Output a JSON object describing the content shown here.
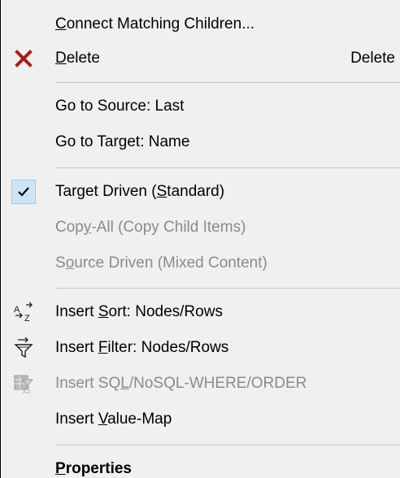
{
  "menu": {
    "items": [
      {
        "pre": "",
        "u": "C",
        "post": "onnect Matching Children...",
        "shortcut": "",
        "disabled": false
      },
      {
        "pre": "",
        "u": "D",
        "post": "elete",
        "shortcut": "Delete",
        "disabled": false
      },
      {
        "pre": "Go to Source: Last",
        "u": "",
        "post": "",
        "shortcut": "",
        "disabled": false
      },
      {
        "pre": "Go to Target: Name",
        "u": "",
        "post": "",
        "shortcut": "",
        "disabled": false
      },
      {
        "pre": "Target Driven (",
        "u": "S",
        "post": "tandard)",
        "shortcut": "",
        "disabled": false,
        "checked": true
      },
      {
        "pre": "Cop",
        "u": "y",
        "post": "-All (Copy Child Items)",
        "shortcut": "",
        "disabled": true
      },
      {
        "pre": "S",
        "u": "o",
        "post": "urce Driven (Mixed Content)",
        "shortcut": "",
        "disabled": true
      },
      {
        "pre": "Insert ",
        "u": "S",
        "post": "ort: Nodes/Rows",
        "shortcut": "",
        "disabled": false
      },
      {
        "pre": "Insert ",
        "u": "F",
        "post": "ilter: Nodes/Rows",
        "shortcut": "",
        "disabled": false
      },
      {
        "pre": "Insert SQ",
        "u": "L",
        "post": "/NoSQL-WHERE/ORDER",
        "shortcut": "",
        "disabled": true
      },
      {
        "pre": "Insert ",
        "u": "V",
        "post": "alue-Map",
        "shortcut": "",
        "disabled": false
      },
      {
        "pre": "",
        "u": "P",
        "post": "roperties",
        "shortcut": "",
        "disabled": false
      }
    ]
  },
  "icons": {
    "delete": "delete-x-icon",
    "check": "checkmark-icon",
    "sort": "sort-a-z-icon",
    "filter": "filter-funnel-icon",
    "sql": "sql-where-icon"
  },
  "colors": {
    "delete_icon": "#b01a1a",
    "disabled_text": "#8a8a8a",
    "check_bg": "#cce4f7"
  }
}
